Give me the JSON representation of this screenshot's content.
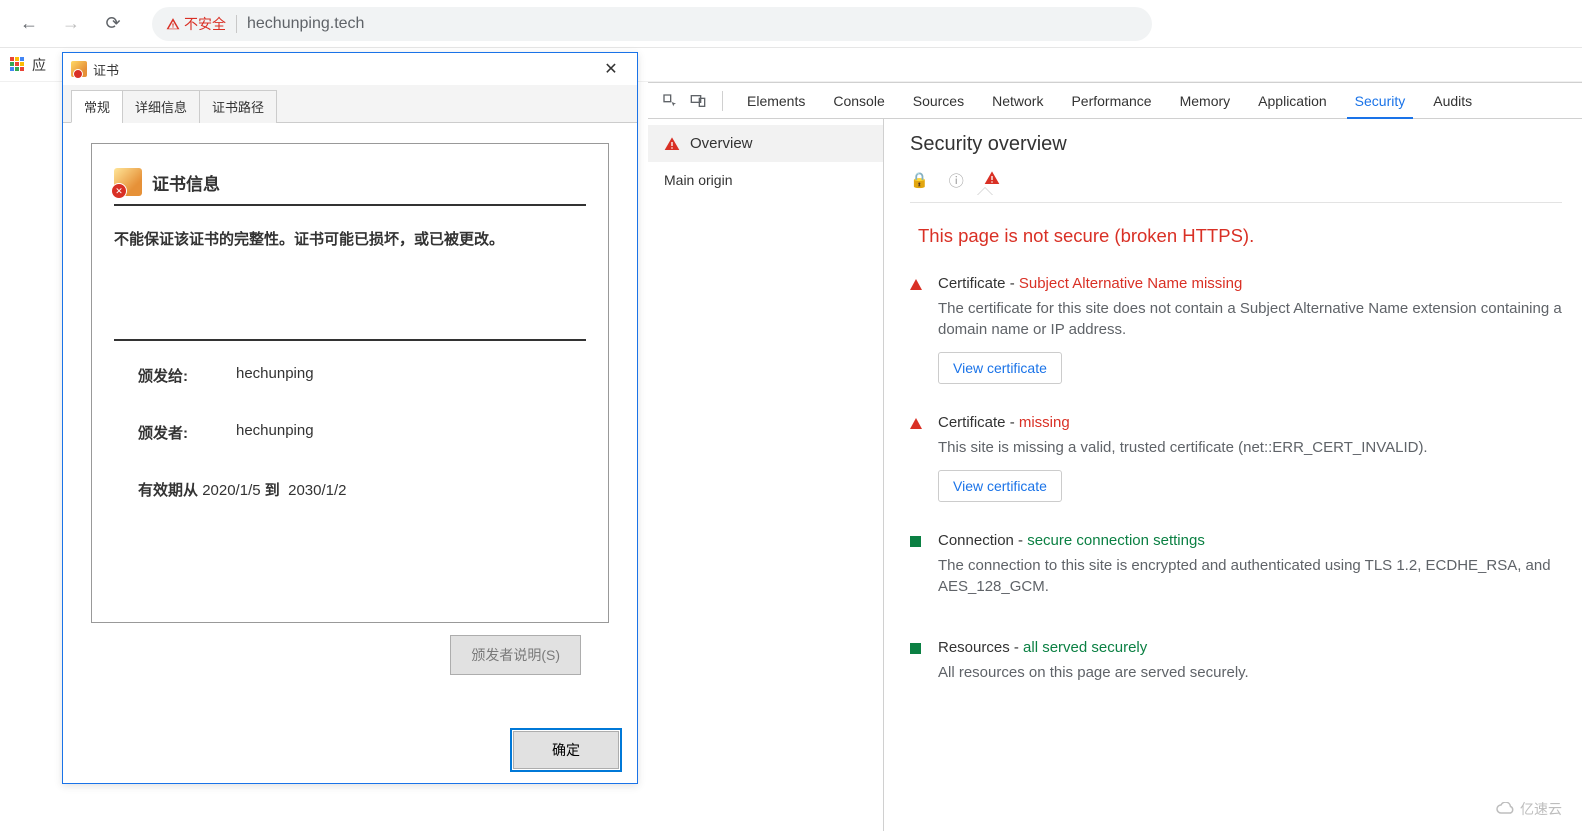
{
  "browser": {
    "not_secure_label": "不安全",
    "url": "hechunping.tech",
    "bookmarks_label": "应"
  },
  "cert_dialog": {
    "window_title": "证书",
    "tabs": {
      "general": "常规",
      "details": "详细信息",
      "path": "证书路径"
    },
    "info_heading": "证书信息",
    "warning_text": "不能保证该证书的完整性。证书可能已损坏，或已被更改。",
    "issued_to_label": "颁发给:",
    "issued_to_value": "hechunping",
    "issued_by_label": "颁发者:",
    "issued_by_value": "hechunping",
    "valid_prefix": "有效期从",
    "valid_from": "2020/1/5",
    "valid_mid": "到",
    "valid_to": "2030/1/2",
    "issuer_statement_btn": "颁发者说明(S)",
    "ok_btn": "确定"
  },
  "devtools": {
    "tabs": {
      "elements": "Elements",
      "console": "Console",
      "sources": "Sources",
      "network": "Network",
      "performance": "Performance",
      "memory": "Memory",
      "application": "Application",
      "security": "Security",
      "audits": "Audits"
    },
    "sidebar": {
      "overview": "Overview",
      "main_origin": "Main origin"
    },
    "title": "Security overview",
    "not_secure": "This page is not secure (broken HTTPS).",
    "cert_san": {
      "label": "Certificate - ",
      "status": "Subject Alternative Name missing",
      "desc": "The certificate for this site does not contain a Subject Alternative Name extension containing a domain name or IP address.",
      "btn": "View certificate"
    },
    "cert_missing": {
      "label": "Certificate - ",
      "status": "missing",
      "desc": "This site is missing a valid, trusted certificate (net::ERR_CERT_INVALID).",
      "btn": "View certificate"
    },
    "connection": {
      "label": "Connection - ",
      "status": "secure connection settings",
      "desc": "The connection to this site is encrypted and authenticated using TLS 1.2, ECDHE_RSA, and AES_128_GCM."
    },
    "resources": {
      "label": "Resources - ",
      "status": "all served securely",
      "desc": "All resources on this page are served securely."
    }
  },
  "watermark": "亿速云"
}
